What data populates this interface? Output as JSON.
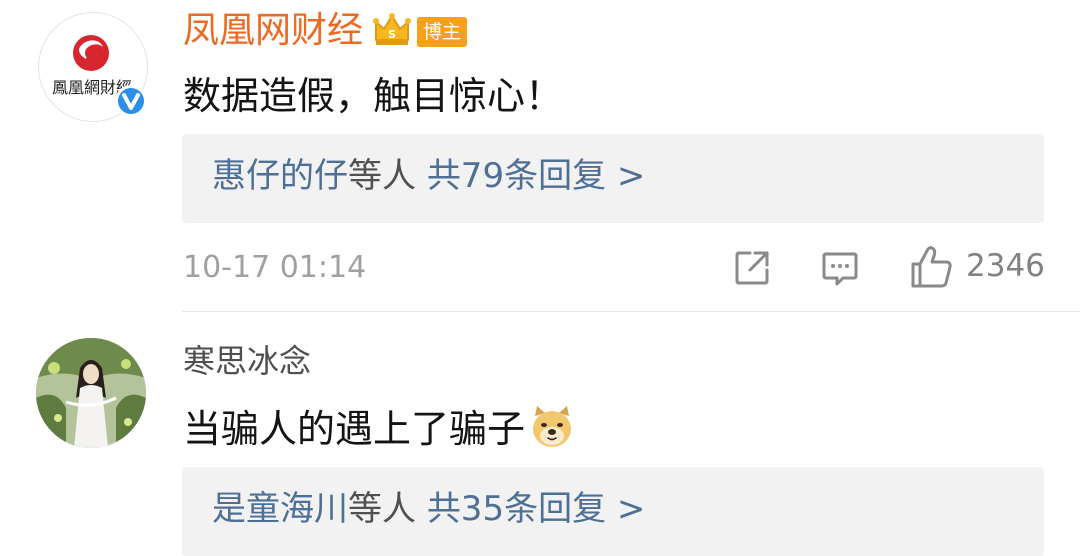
{
  "comments": [
    {
      "username": "凤凰网财经",
      "avatar_text": "鳳凰網財經",
      "username_color": "#ec6a22",
      "verified": true,
      "badge": "博主",
      "content": "数据造假，触目惊心！",
      "replies": {
        "names": "惠仔的仔",
        "etc": "等人",
        "count": "共79条回复",
        "chevron": ">"
      },
      "timestamp": "10-17 01:14",
      "likes": "2346"
    },
    {
      "username": "寒思冰念",
      "username_color": "#4f4f4f",
      "content": "当骗人的遇上了骗子",
      "emoji": "doge-emoji",
      "replies": {
        "names": "是童海川",
        "etc": "等人",
        "count": "共35条回复",
        "chevron": ">"
      }
    }
  ],
  "icons": {
    "share": "share-icon",
    "comment": "comment-icon",
    "like": "thumbs-up-icon",
    "crown": "crown-icon",
    "verified": "verified-badge-icon"
  },
  "colors": {
    "link": "#4e6f96",
    "badge": "#f7a11a",
    "verified": "#2b8ee8"
  }
}
